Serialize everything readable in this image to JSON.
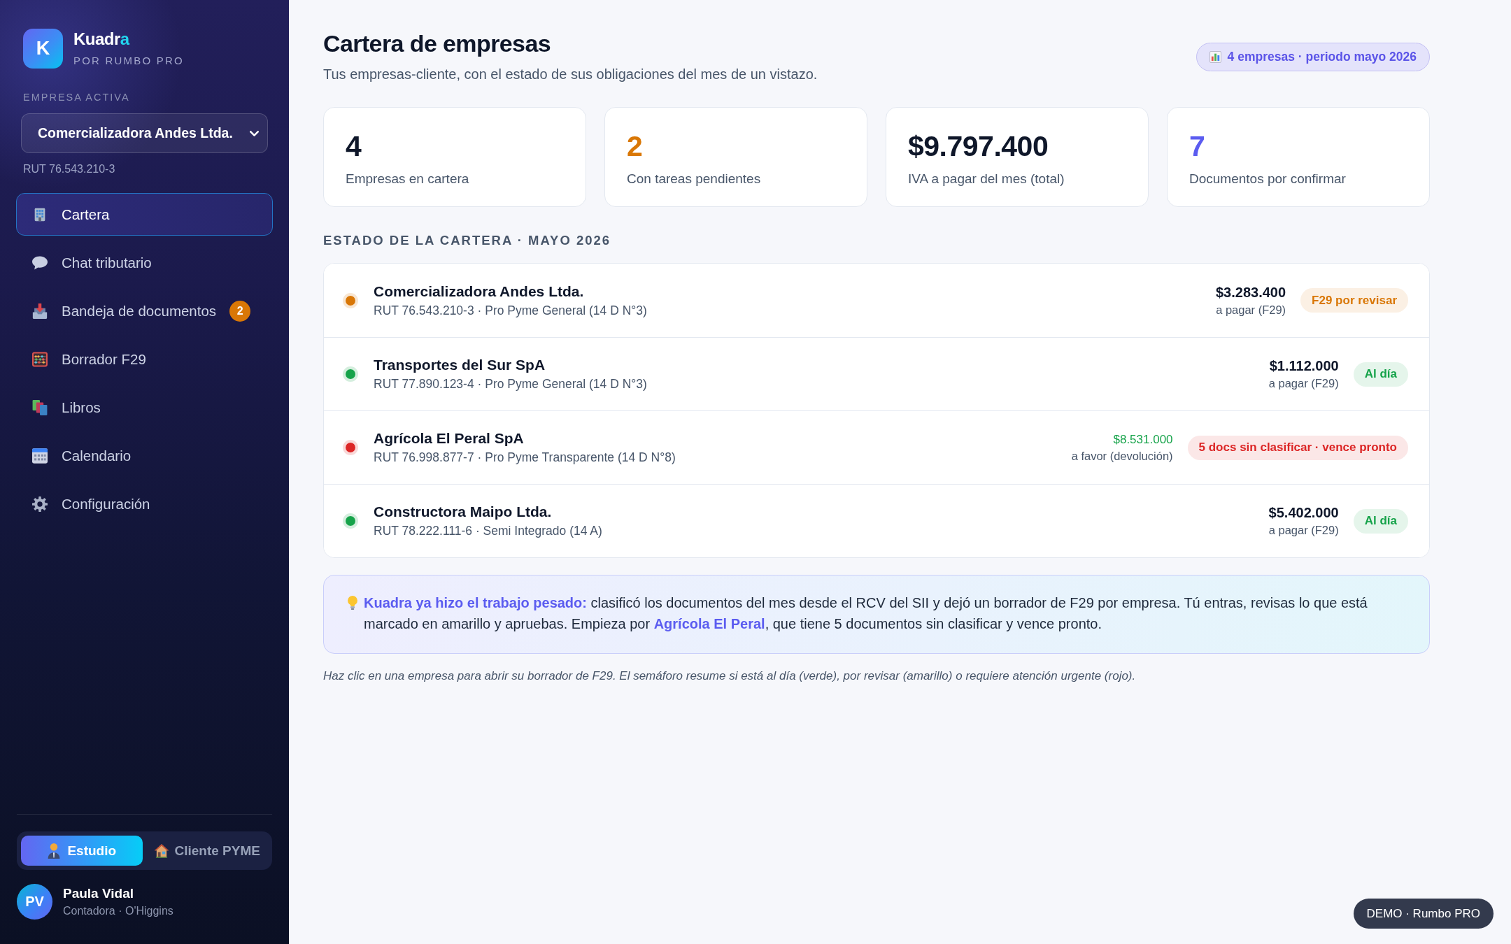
{
  "sidebar": {
    "brand": {
      "logo_letter": "K",
      "name": "Kuadr",
      "name_accent": "a",
      "tagline": "POR RUMBO PRO"
    },
    "active_company": {
      "label": "EMPRESA ACTIVA",
      "select": {
        "value": "Comercializadora Andes Ltda."
      },
      "rut": "RUT 76.543.210-3"
    },
    "nav_items": [
      {
        "label": "Cartera",
        "selected": true
      },
      {
        "label": "Chat tributario",
        "selected": false
      },
      {
        "label": "Bandeja de documentos",
        "selected": false,
        "badge": "2"
      },
      {
        "label": "Borrador F29",
        "selected": false
      },
      {
        "label": "Libros",
        "selected": false
      },
      {
        "label": "Calendario",
        "selected": false
      },
      {
        "label": "Configuración",
        "selected": false
      }
    ],
    "modes": [
      {
        "label": "Estudio",
        "selected": true
      },
      {
        "label": "Cliente PYME",
        "selected": false
      }
    ],
    "user": {
      "initials": "PV",
      "name": "Paula Vidal",
      "role": "Contadora · O'Higgins"
    }
  },
  "header": {
    "title": "Cartera de empresas",
    "subtitle": "Tus empresas-cliente, con el estado de sus obligaciones del mes de un vistazo.",
    "period_badge": "4 empresas · periodo mayo 2026"
  },
  "stats": [
    {
      "value": "4",
      "label": "Empresas en cartera",
      "color": "#0f172a"
    },
    {
      "value": "2",
      "label": "Con tareas pendientes",
      "color": "#d97706"
    },
    {
      "value": "$9.797.400",
      "label": "IVA a pagar del mes (total)",
      "color": "#0f172a"
    },
    {
      "value": "7",
      "label": "Documentos por confirmar",
      "color": "#5b5cf0"
    }
  ],
  "portfolio": {
    "heading": "ESTADO DE LA CARTERA · MAYO 2026",
    "companies": [
      {
        "name": "Comercializadora Andes Ltda.",
        "details": "RUT 76.543.210-3 · Pro Pyme General (14 D N°3)",
        "color": "#d97706",
        "kind": "payable",
        "amount": "$3.283.400",
        "amount_caption": "a pagar (F29)",
        "status": "F29 por revisar"
      },
      {
        "name": "Transportes del Sur SpA",
        "details": "RUT 77.890.123-4 · Pro Pyme General (14 D N°3)",
        "color": "#16a34a",
        "kind": "payable",
        "amount": "$1.112.000",
        "amount_caption": "a pagar (F29)",
        "status": "Al día"
      },
      {
        "name": "Agrícola El Peral SpA",
        "details": "RUT 76.998.877-7 · Pro Pyme Transparente (14 D N°8)",
        "color": "#dc2626",
        "kind": "refund",
        "amount": "$8.531.000",
        "amount_caption": "a favor (devolución)",
        "status": "5 docs sin clasificar · vence pronto"
      },
      {
        "name": "Constructora Maipo Ltda.",
        "details": "RUT 78.222.111-6 · Semi Integrado (14 A)",
        "color": "#16a34a",
        "kind": "payable",
        "amount": "$5.402.000",
        "amount_caption": "a pagar (F29)",
        "status": "Al día"
      }
    ]
  },
  "tip": {
    "text": "**Kuadra ya hizo el trabajo pesado:** clasificó los documentos del mes desde el RCV del SII y dejó un borrador de F29 por empresa. Tú entras, revisas lo que está marcado en amarillo y apruebas. Empieza por",
    "link": "Agrícola El Peral",
    "text_after": ", que tiene 5 documentos sin clasificar y vence pronto."
  },
  "footnote": "Haz clic en una empresa para abrir su borrador de F29. El semáforo resume si está al día (verde), por revisar (amarillo) o requiere atención urgente (rojo).",
  "demo_badge": "DEMO · Rumbo PRO"
}
